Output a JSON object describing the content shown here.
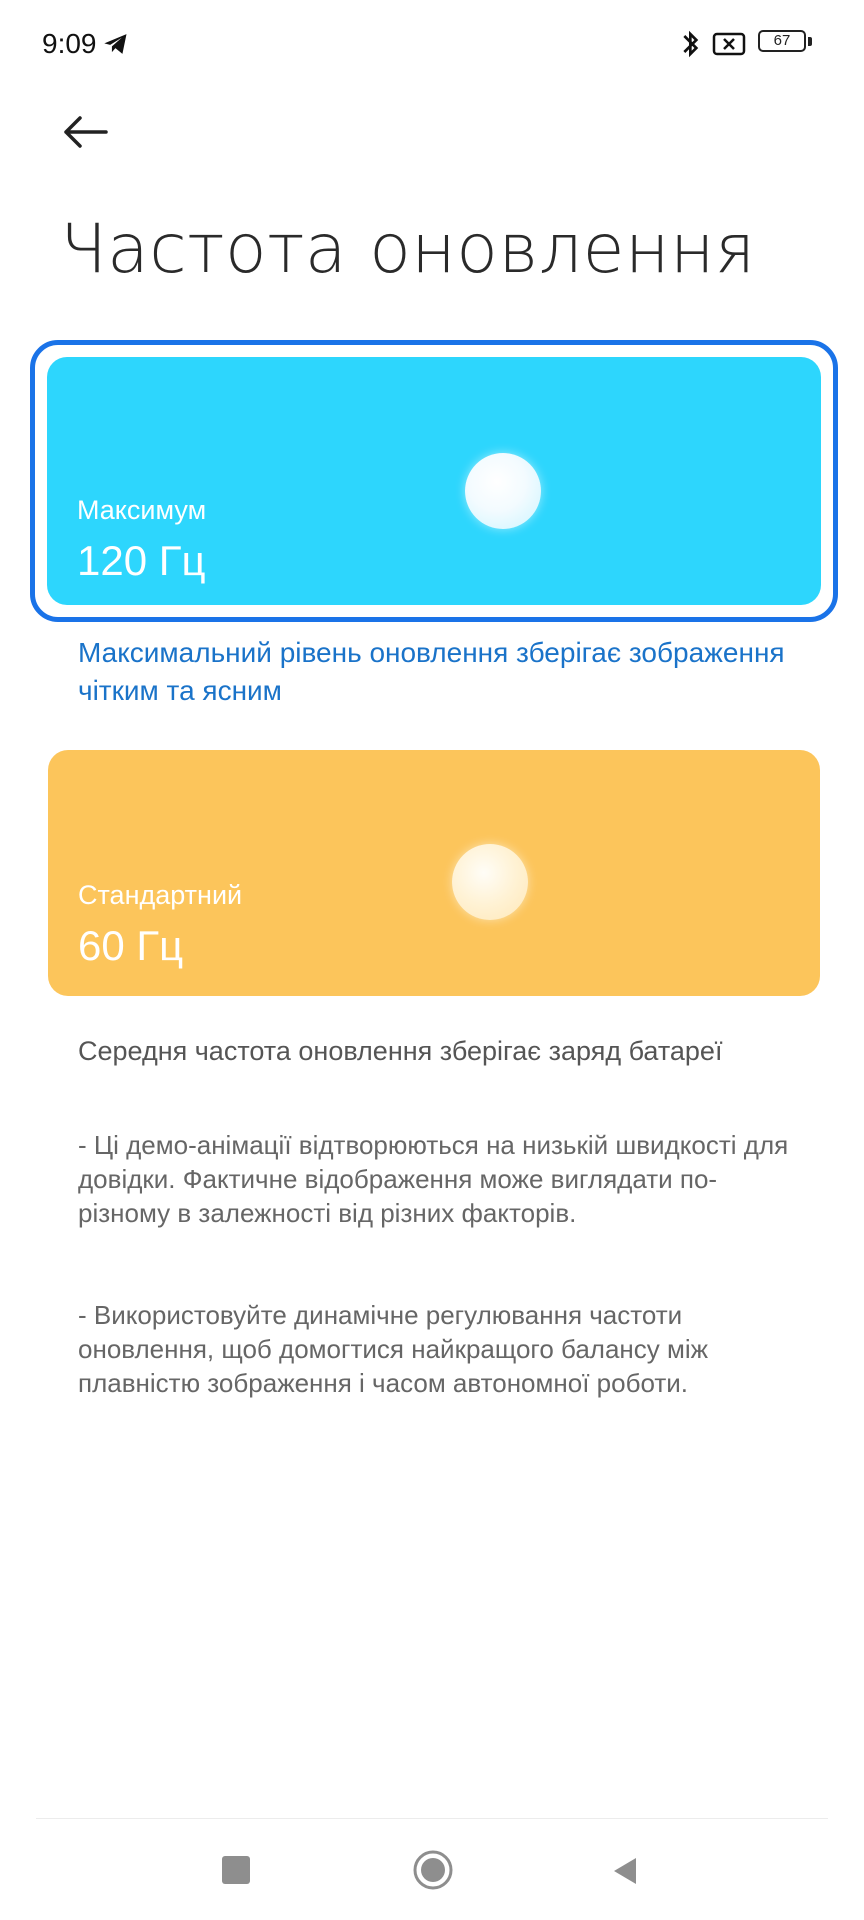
{
  "status_bar": {
    "time": "9:09",
    "battery_level": "67",
    "icons": [
      "telegram-icon",
      "bluetooth-icon",
      "no-sim-icon",
      "battery-icon"
    ]
  },
  "header": {
    "back_icon": "arrow-left-icon",
    "title": "Частота оновлення"
  },
  "options": {
    "max": {
      "label": "Максимум",
      "value": "120 Гц",
      "description": "Максимальний рівень оновлення зберігає зображення чітким та ясним",
      "selected": true,
      "color": "#2dd6fd"
    },
    "standard": {
      "label": "Стандартний",
      "value": "60 Гц",
      "description": "Середня частота оновлення зберігає заряд батареї",
      "selected": false,
      "color": "#fcc55b"
    }
  },
  "notes": {
    "note1": "- Ці демо-анімації відтворюються на низькій швидкості для довідки. Фактичне відображення може виглядати по-різному в залежності від різних факторів.",
    "note2": "- Використовуйте динамічне регулювання частоти оновлення, щоб домогтися найкращого балансу між плавністю зображення і часом автономної роботи."
  },
  "navbar": {
    "icons": [
      "recents-icon",
      "home-icon",
      "back-triangle-icon"
    ]
  },
  "colors": {
    "accent": "#1a73e8",
    "description_accent": "#1a73c9"
  }
}
